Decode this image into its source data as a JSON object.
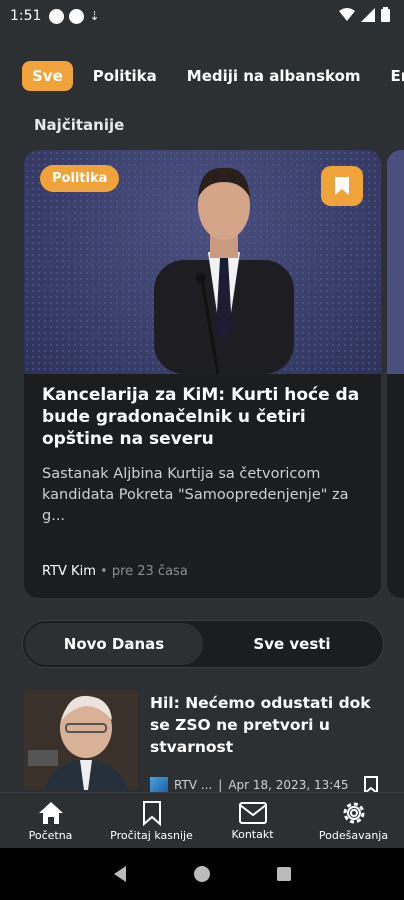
{
  "status": {
    "time": "1:51"
  },
  "categories": [
    "Sve",
    "Politika",
    "Mediji na albanskom",
    "En"
  ],
  "section_title": "Najčitanije",
  "featured": {
    "tag": "Politika",
    "title": "Kancelarija za KiM: Kurti hoće da bude gradonačelnik u četiri opštine na severu",
    "description": "Sastanak Aljbina Kurtija sa četvoricom kandidata Pokreta \"Samoopredenjenje\" za g...",
    "source": "RTV Kim",
    "time": "pre 23 časa"
  },
  "toggle": {
    "left": "Novo Danas",
    "right": "Sve vesti"
  },
  "news": {
    "title": "Hil: Nećemo odustati dok se ZSO ne pretvori u stvarnost",
    "source": "RTV ...",
    "date": "Apr 18, 2023, 13:45"
  },
  "bottom_nav": {
    "home": "Početna",
    "read_later": "Pročitaj kasnije",
    "contact": "Kontakt",
    "settings": "Podešavanja"
  },
  "colors": {
    "accent": "#f0a33a",
    "background": "#2c3033",
    "card": "#1b1d1f"
  }
}
